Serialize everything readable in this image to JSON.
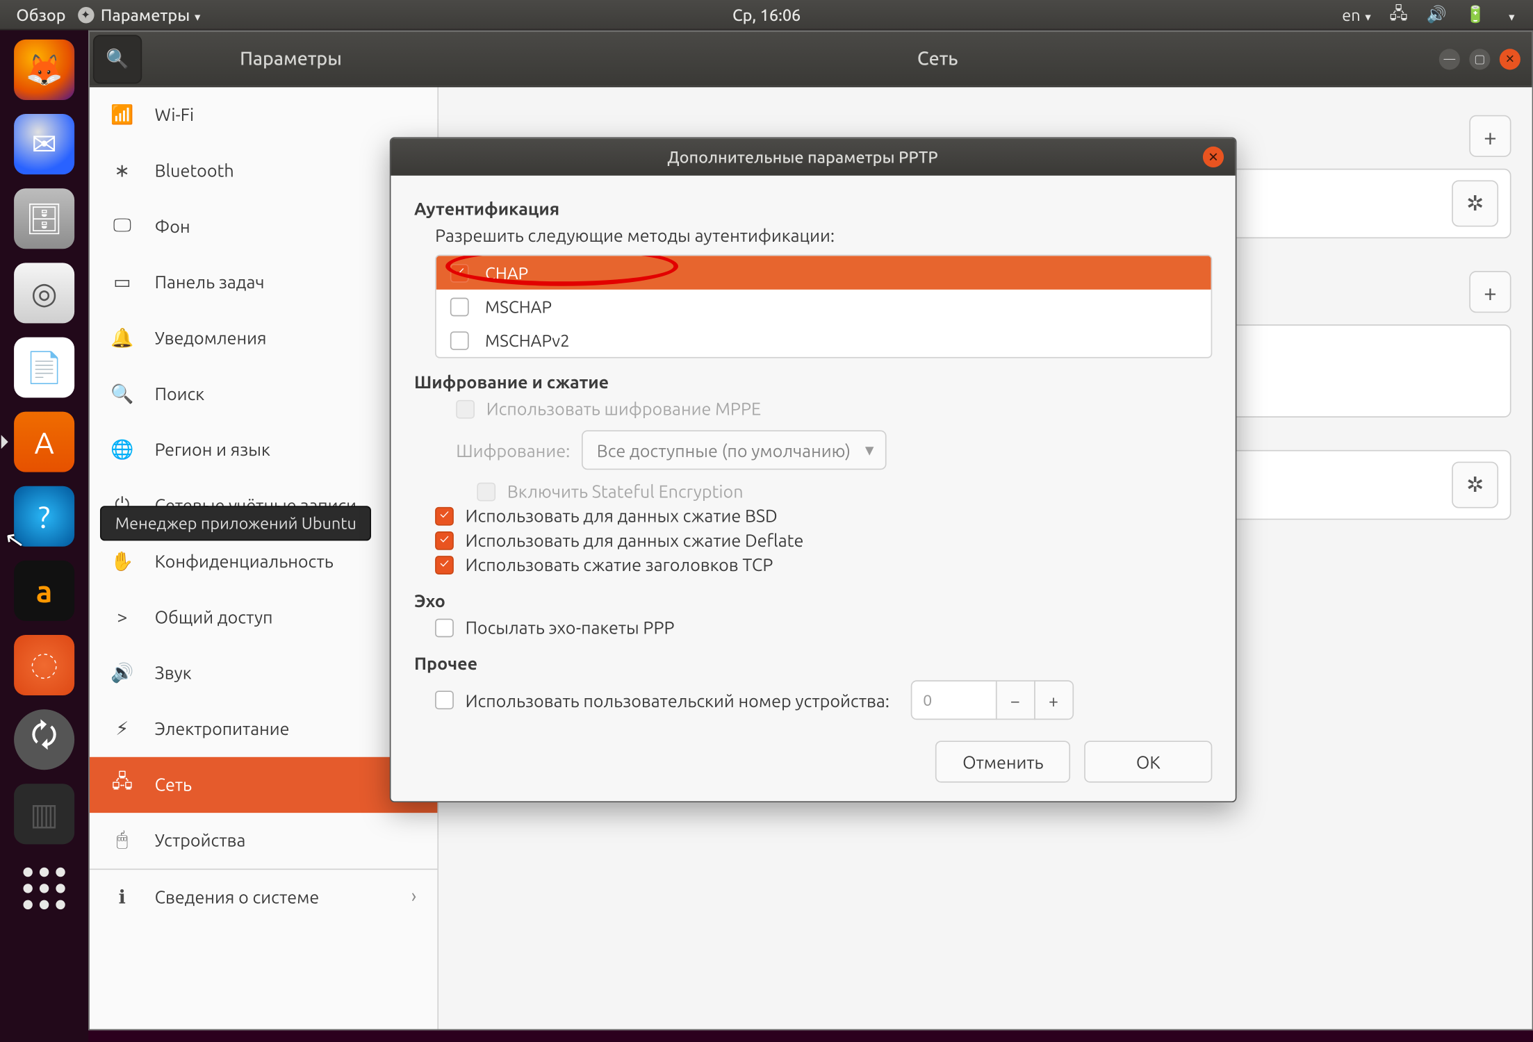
{
  "topbar": {
    "overview": "Обзор",
    "app_name": "Параметры",
    "clock": "Ср, 16:06",
    "lang": "en"
  },
  "tooltip": "Менеджер приложений Ubuntu",
  "settings": {
    "header_left": "Параметры",
    "header_main": "Сеть"
  },
  "sidebar": {
    "items": [
      {
        "icon": "📶",
        "label": "Wi-Fi"
      },
      {
        "icon": "∗",
        "label": "Bluetooth"
      },
      {
        "icon": "🖵",
        "label": "Фон"
      },
      {
        "icon": "▭",
        "label": "Панель задач"
      },
      {
        "icon": "🔔",
        "label": "Уведомления"
      },
      {
        "icon": "🔍",
        "label": "Поиск"
      },
      {
        "icon": "🌐",
        "label": "Регион и язык"
      },
      {
        "icon": "⏻",
        "label": "Сетевые учётные записи"
      },
      {
        "icon": "✋",
        "label": "Конфиденциальность"
      },
      {
        "icon": "<",
        "label": "Общий доступ"
      },
      {
        "icon": "🔊",
        "label": "Звук"
      },
      {
        "icon": "⚡",
        "label": "Электропитание"
      },
      {
        "icon": "🖧",
        "label": "Сеть"
      },
      {
        "icon": "🖱",
        "label": "Устройства"
      }
    ],
    "details": {
      "icon": "ℹ",
      "label": "Сведения о системе"
    }
  },
  "dialog": {
    "title": "Дополнительные параметры PPTP",
    "auth_section": "Аутентификация",
    "auth_sub": "Разрешить следующие методы аутентификации:",
    "auth_methods": [
      {
        "label": "CHAP",
        "checked": true,
        "selected": true
      },
      {
        "label": "MSCHAP",
        "checked": false,
        "selected": false
      },
      {
        "label": "MSCHAPv2",
        "checked": false,
        "selected": false
      }
    ],
    "enc_section": "Шифрование и сжатие",
    "enc_mppe": "Использовать шифрование MPPE",
    "enc_label": "Шифрование:",
    "enc_combo": "Все доступные (по умолчанию)",
    "enc_stateful": "Включить Stateful Encryption",
    "compress_bsd": "Использовать для данных сжатие BSD",
    "compress_deflate": "Использовать для данных сжатие Deflate",
    "compress_tcp": "Использовать сжатие заголовков TCP",
    "echo_section": "Эхо",
    "echo_opt": "Посылать эхо-пакеты PPP",
    "misc_section": "Прочее",
    "misc_unit": "Использовать пользовательский номер устройства:",
    "unit_value": "0",
    "cancel": "Отменить",
    "ok": "ОК"
  }
}
